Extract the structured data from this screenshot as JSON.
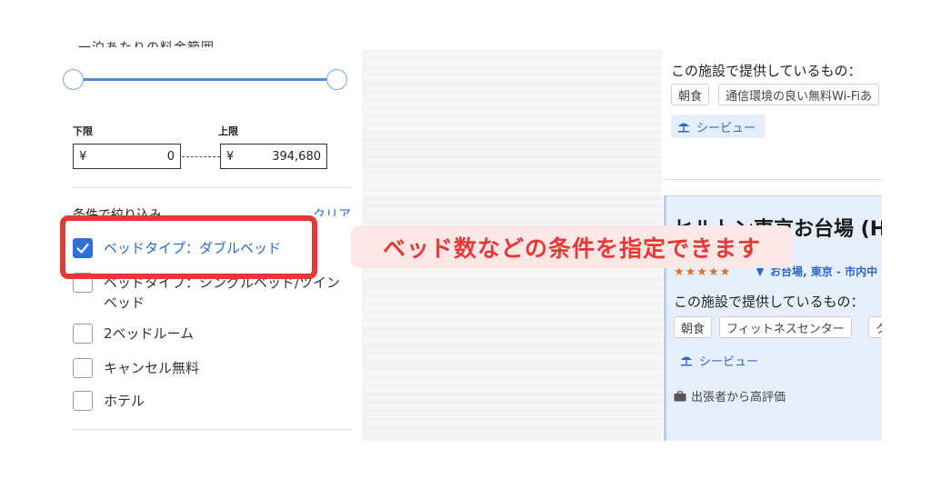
{
  "filter_panel": {
    "price_range": {
      "min_label": "下限",
      "max_label": "上限",
      "currency": "¥",
      "min_value": "0",
      "max_value": "394,680"
    },
    "filter_heading": "条件で絞り込み",
    "clear_label": "クリア",
    "options": [
      {
        "label": "ベッドタイプ：ダブルベッド",
        "checked": true
      },
      {
        "label": "ベッドタイプ：シングルベッド/ツインベッド",
        "checked": false
      },
      {
        "label": "2ベッドルーム",
        "checked": false
      },
      {
        "label": "キャンセル無料",
        "checked": false
      },
      {
        "label": "ホテル",
        "checked": false
      }
    ]
  },
  "callout": {
    "text": "ベッド数などの条件を指定できます",
    "color": "#e53935"
  },
  "listings": {
    "card1": {
      "amenities_heading": "この施設で提供しているもの：",
      "tags": [
        "朝食",
        "通信環境の良い無料Wi-Fiあ"
      ],
      "feature": "シービュー"
    },
    "card2": {
      "title": "ヒルトン東京お台場 (H",
      "stars": "★★★★★",
      "location": "お台場, 東京 - 市内中",
      "amenities_heading": "この施設で提供しているもの：",
      "tags": [
        "朝食",
        "フィットネスセンター",
        "ク"
      ],
      "feature": "シービュー",
      "badge": "出張者から高評価"
    }
  },
  "colors": {
    "accent": "#2a6ad0",
    "highlight": "#e53935",
    "slider": "#4a90e2"
  }
}
